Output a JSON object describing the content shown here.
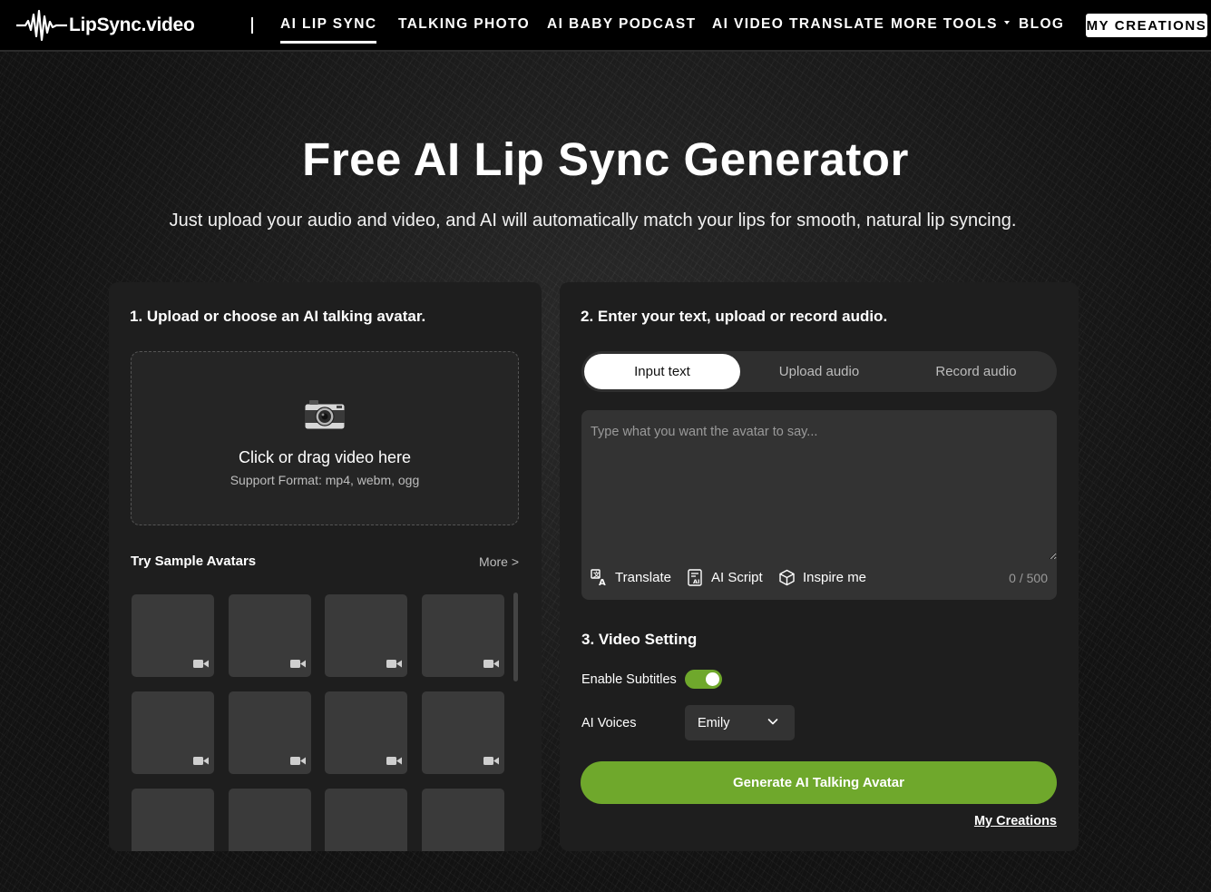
{
  "brand": {
    "name": "LipSync.video"
  },
  "nav": {
    "items": [
      {
        "label": "AI LIP SYNC",
        "active": true
      },
      {
        "label": "TALKING PHOTO"
      },
      {
        "label": "AI BABY PODCAST"
      },
      {
        "label": "AI VIDEO TRANSLATE"
      },
      {
        "label": "MORE TOOLS",
        "dropdown": true
      },
      {
        "label": "BLOG"
      }
    ],
    "creations_button": "MY CREATIONS"
  },
  "hero": {
    "title": "Free AI Lip Sync Generator",
    "subtitle": "Just upload your audio and video, and AI will automatically match your lips for smooth, natural lip syncing."
  },
  "step1": {
    "title": "1. Upload or choose an AI talking avatar.",
    "dropzone": {
      "icon": "camera-icon",
      "main": "Click or drag video here",
      "sub": "Support Format: mp4, webm, ogg"
    },
    "samples": {
      "title": "Try Sample Avatars",
      "more": "More >",
      "thumb_icon": "video-camera-icon"
    }
  },
  "step2": {
    "title": "2. Enter your text, upload or record audio.",
    "tabs": [
      {
        "label": "Input text",
        "active": true
      },
      {
        "label": "Upload audio"
      },
      {
        "label": "Record audio"
      }
    ],
    "textarea": {
      "placeholder": "Type what you want the avatar to say...",
      "value": ""
    },
    "tools": [
      {
        "label": "Translate",
        "icon": "translate-icon"
      },
      {
        "label": "AI Script",
        "icon": "ai-script-icon"
      },
      {
        "label": "Inspire me",
        "icon": "cube-icon"
      }
    ],
    "counter": "0 / 500"
  },
  "step3": {
    "title": "3. Video Setting",
    "subtitles_label": "Enable Subtitles",
    "subtitles_enabled": true,
    "voices_label": "AI Voices",
    "voice_selected": "Emily"
  },
  "actions": {
    "generate": "Generate AI Talking Avatar",
    "my_creations": "My Creations"
  },
  "colors": {
    "accent": "#6fa82c",
    "card": "#1e1e1e",
    "nav": "#000000"
  }
}
